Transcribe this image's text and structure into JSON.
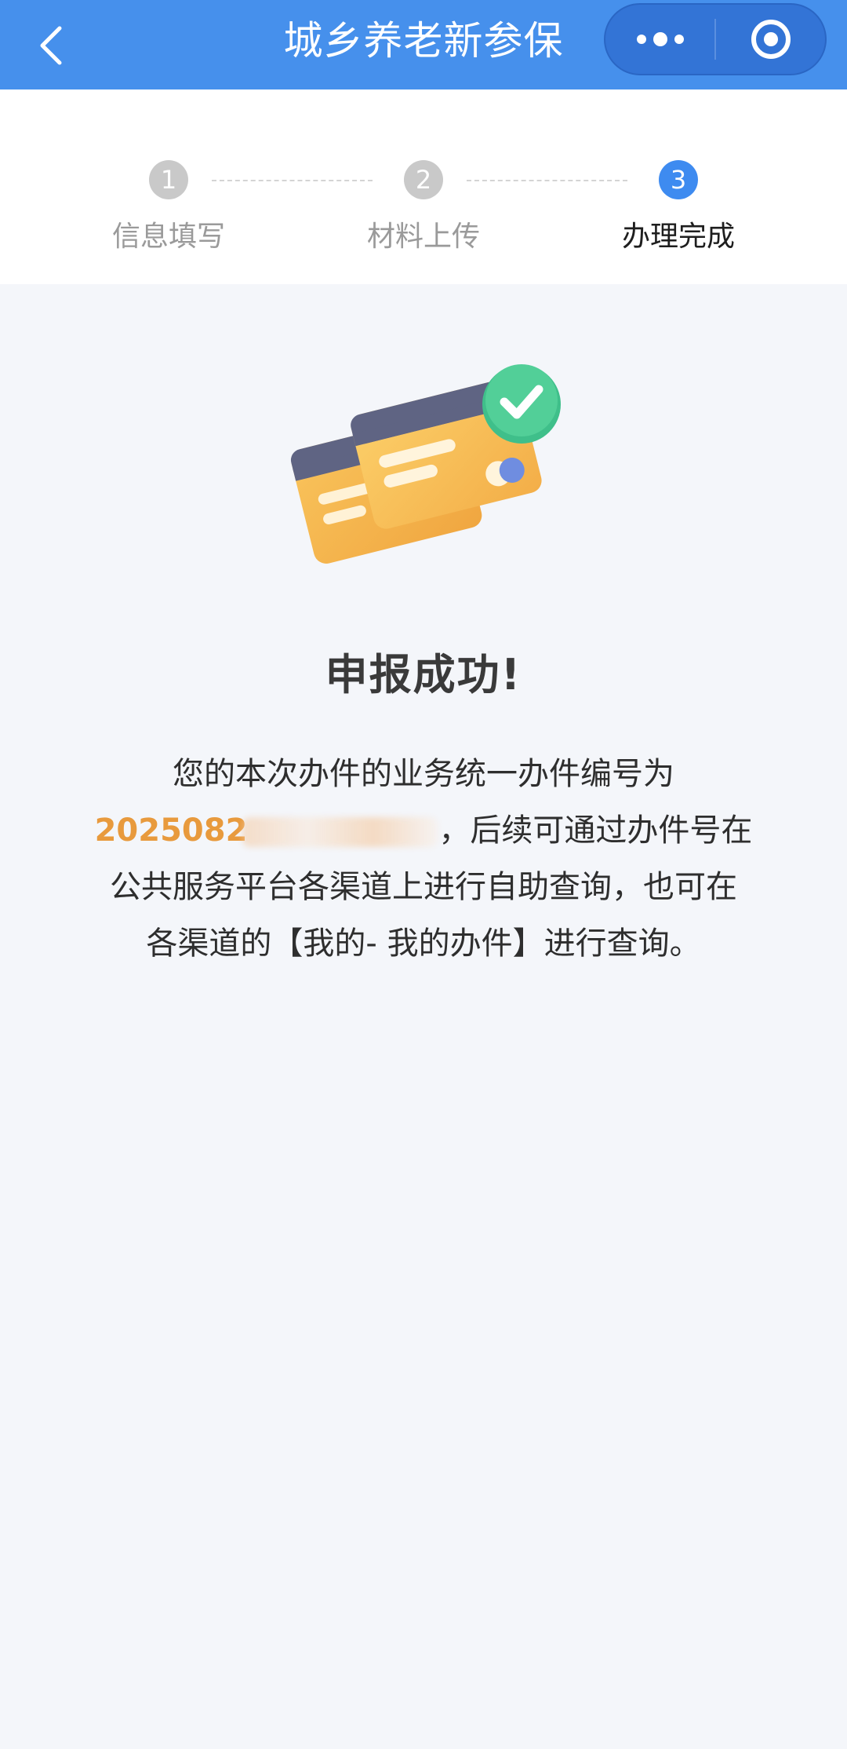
{
  "appbar": {
    "title": "城乡养老新参保",
    "back_icon": "chevron-left-icon",
    "more_icon": "more-dots-icon",
    "close_icon": "target-circle-icon",
    "background": "#4690ec"
  },
  "stepper": {
    "steps": [
      {
        "number": "1",
        "label": "信息填写",
        "active": false
      },
      {
        "number": "2",
        "label": "材料上传",
        "active": false
      },
      {
        "number": "3",
        "label": "办理完成",
        "active": true
      }
    ],
    "active_color": "#3e8bf0",
    "inactive_color": "#c9c9c9"
  },
  "result": {
    "illustration_icon": "cards-check-icon",
    "title": "申报成功!",
    "desc_line1": "您的本次办件的业务统一办件编号为",
    "case_number_visible": "2025082",
    "desc_after_number": "，后续可通过办件号在",
    "desc_line3": "公共服务平台各渠道上进行自助查询，也可在",
    "desc_line4": "各渠道的【我的- 我的办件】进行查询。",
    "case_number_color": "#e89a3d"
  }
}
